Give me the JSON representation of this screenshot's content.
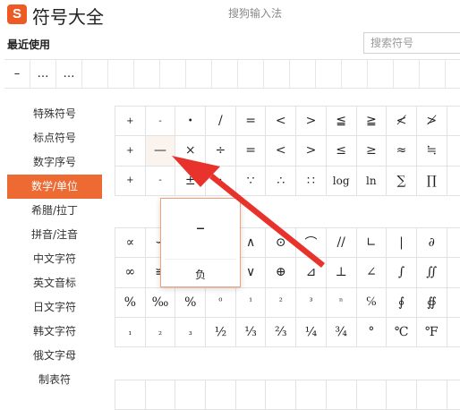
{
  "header": {
    "title": "符号大全",
    "ime_title": "搜狗输入法",
    "logo_letter": "S"
  },
  "recent": {
    "label": "最近使用",
    "items": [
      "–",
      "…",
      "…",
      "",
      "",
      "",
      "",
      "",
      "",
      "",
      "",
      "",
      "",
      "",
      "",
      "",
      ""
    ]
  },
  "search": {
    "placeholder": "搜索符号"
  },
  "sidebar": {
    "items": [
      {
        "label": "特殊符号"
      },
      {
        "label": "标点符号"
      },
      {
        "label": "数字序号"
      },
      {
        "label": "数学/单位"
      },
      {
        "label": "希腊/拉丁"
      },
      {
        "label": "拼音/注音"
      },
      {
        "label": "中文字符"
      },
      {
        "label": "英文音标"
      },
      {
        "label": "日文字符"
      },
      {
        "label": "韩文字符"
      },
      {
        "label": "俄文字母"
      },
      {
        "label": "制表符"
      }
    ],
    "active_index": 3
  },
  "grid1": [
    [
      "+",
      "-",
      "•",
      "/",
      "=",
      "<",
      ">",
      "≦",
      "≧",
      "≮",
      "≯",
      ""
    ],
    [
      "+",
      "—",
      "×",
      "÷",
      "=",
      "<",
      ">",
      "≤",
      "≥",
      "≈",
      "≒",
      ""
    ],
    [
      "+",
      "-",
      "±",
      ":",
      "∵",
      "∴",
      "∷",
      "log",
      "ln",
      "∑",
      "∏",
      "·"
    ]
  ],
  "grid2": [
    [
      "∝",
      "∽",
      "",
      "",
      "∧",
      "⊙",
      "⌒",
      "//",
      "∟",
      "|",
      "∂",
      ""
    ],
    [
      "∞",
      "≌",
      "",
      "",
      "∨",
      "⊕",
      "⊿",
      "⊥",
      "∠",
      "∫",
      "∬",
      ""
    ],
    [
      "%",
      "‰",
      "%",
      "⁰",
      "¹",
      "²",
      "³",
      "ⁿ",
      "℅",
      "∮",
      "∯",
      ""
    ],
    [
      "₁",
      "₂",
      "₃",
      "½",
      "⅓",
      "⅔",
      "¼",
      "¾",
      "°",
      "℃",
      "℉",
      ""
    ]
  ],
  "grid3": [
    [
      "",
      "",
      "",
      "",
      "",
      "",
      "",
      "",
      "",
      "",
      "",
      ""
    ]
  ],
  "popup": {
    "glyph": "–",
    "name": "负"
  },
  "colors": {
    "accent": "#ee6a33",
    "logo": "#ee5a24",
    "arrow": "#e8322c"
  }
}
